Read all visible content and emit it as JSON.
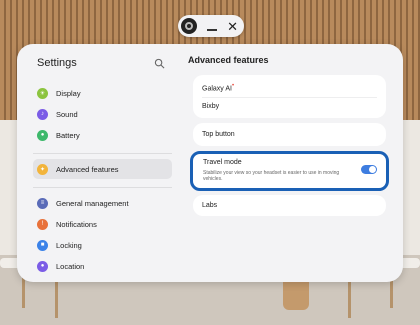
{
  "window": {
    "close_symbol": "✕"
  },
  "sidebar": {
    "title": "Settings",
    "items": [
      {
        "label": "Display",
        "icon": "display-icon",
        "color": "#8cc43f"
      },
      {
        "label": "Sound",
        "icon": "sound-icon",
        "color": "#7b5ce6"
      },
      {
        "label": "Battery",
        "icon": "battery-icon",
        "color": "#3db86b"
      },
      {
        "label": "Advanced features",
        "icon": "advanced-features-icon",
        "color": "#f2b43b",
        "active": true
      },
      {
        "label": "General management",
        "icon": "general-management-icon",
        "color": "#5a6bb8"
      },
      {
        "label": "Notifications",
        "icon": "notifications-icon",
        "color": "#e8713a"
      },
      {
        "label": "Locking",
        "icon": "locking-icon",
        "color": "#3b82e8"
      },
      {
        "label": "Location",
        "icon": "location-icon",
        "color": "#7b5ce6"
      }
    ]
  },
  "content": {
    "title": "Advanced features",
    "galaxy_ai": "Galaxy AI",
    "galaxy_ai_badge": "•",
    "bixby": "Bixby",
    "top_button": "Top button",
    "travel_mode": {
      "title": "Travel mode",
      "description": "Stabilize your view so your headset is easier to use in moving vehicles.",
      "enabled": true,
      "accent": "#1a60b5"
    },
    "labs": "Labs"
  }
}
